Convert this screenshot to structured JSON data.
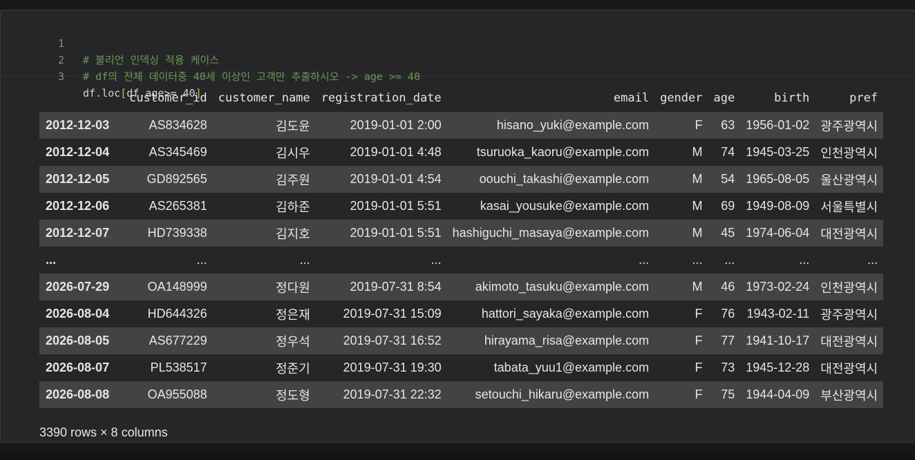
{
  "code": {
    "lines": [
      {
        "no": "1",
        "text": "# 불리언 인덱싱 적용 케이스"
      },
      {
        "no": "2",
        "text": "# df의 전체 데이터중 40세 이상인 고객만 추출하시오 -> age >= 40"
      },
      {
        "no": "3",
        "prefix": "df.loc",
        "open": "[",
        "inner": "df.age>= 40",
        "close": "]"
      }
    ]
  },
  "table": {
    "columns": [
      "",
      "customer_id",
      "customer_name",
      "registration_date",
      "email",
      "gender",
      "age",
      "birth",
      "pref"
    ],
    "rows": [
      [
        "2012-12-03",
        "AS834628",
        "김도윤",
        "2019-01-01 2:00",
        "hisano_yuki@example.com",
        "F",
        "63",
        "1956-01-02",
        "광주광역시"
      ],
      [
        "2012-12-04",
        "AS345469",
        "김시우",
        "2019-01-01 4:48",
        "tsuruoka_kaoru@example.com",
        "M",
        "74",
        "1945-03-25",
        "인천광역시"
      ],
      [
        "2012-12-05",
        "GD892565",
        "김주원",
        "2019-01-01 4:54",
        "oouchi_takashi@example.com",
        "M",
        "54",
        "1965-08-05",
        "울산광역시"
      ],
      [
        "2012-12-06",
        "AS265381",
        "김하준",
        "2019-01-01 5:51",
        "kasai_yousuke@example.com",
        "M",
        "69",
        "1949-08-09",
        "서울특별시"
      ],
      [
        "2012-12-07",
        "HD739338",
        "김지호",
        "2019-01-01 5:51",
        "hashiguchi_masaya@example.com",
        "M",
        "45",
        "1974-06-04",
        "대전광역시"
      ],
      [
        "...",
        "...",
        "...",
        "...",
        "...",
        "...",
        "...",
        "...",
        "..."
      ],
      [
        "2026-07-29",
        "OA148999",
        "정다원",
        "2019-07-31 8:54",
        "akimoto_tasuku@example.com",
        "M",
        "46",
        "1973-02-24",
        "인천광역시"
      ],
      [
        "2026-08-04",
        "HD644326",
        "정은재",
        "2019-07-31 15:09",
        "hattori_sayaka@example.com",
        "F",
        "76",
        "1943-02-11",
        "광주광역시"
      ],
      [
        "2026-08-05",
        "AS677229",
        "정우석",
        "2019-07-31 16:52",
        "hirayama_risa@example.com",
        "F",
        "77",
        "1941-10-17",
        "대전광역시"
      ],
      [
        "2026-08-07",
        "PL538517",
        "정준기",
        "2019-07-31 19:30",
        "tabata_yuu1@example.com",
        "F",
        "73",
        "1945-12-28",
        "대전광역시"
      ],
      [
        "2026-08-08",
        "OA955088",
        "정도형",
        "2019-07-31 22:32",
        "setouchi_hikaru@example.com",
        "F",
        "75",
        "1944-04-09",
        "부산광역시"
      ]
    ]
  },
  "footer": "3390 rows × 8 columns"
}
